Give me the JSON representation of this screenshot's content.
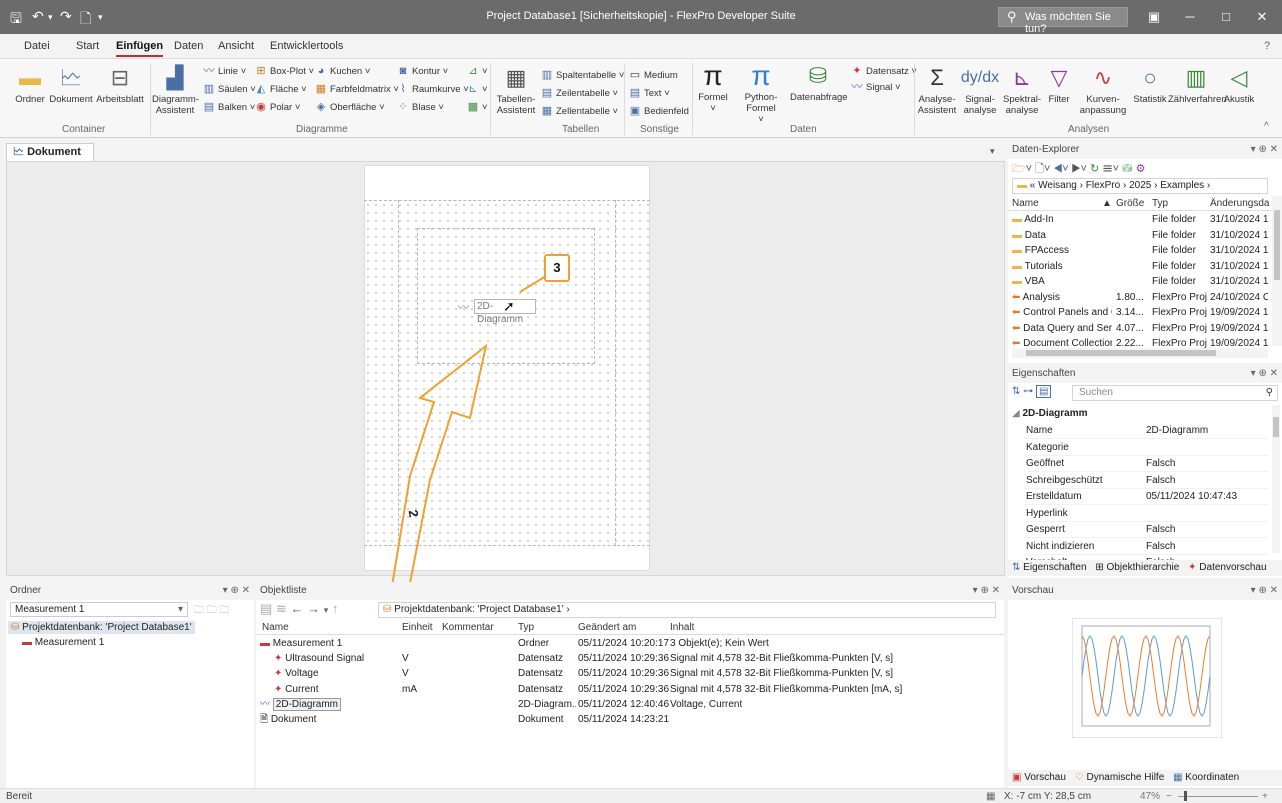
{
  "titlebar": {
    "title": "Project Database1 [Sicherheitskopie] - FlexPro Developer Suite",
    "search_placeholder": "Was möchten Sie tun?"
  },
  "tabs": [
    "Datei",
    "Start",
    "Einfügen",
    "Daten",
    "Ansicht",
    "Entwicklertools"
  ],
  "active_tab": "Einfügen",
  "ribbon": {
    "container": {
      "label": "Container",
      "items": [
        "Ordner",
        "Dokument",
        "Arbeitsblatt"
      ]
    },
    "diagramme": {
      "label": "Diagramme",
      "assistant": "Diagramm-\nAssistent",
      "small": [
        "Linie",
        "Box-Plot",
        "Kuchen",
        "Säulen",
        "Fläche",
        "Farbfeldmatrix",
        "Balken",
        "Polar",
        "Oberfläche",
        "Kontur",
        "Raumkurve",
        "Blase"
      ]
    },
    "tabellen": {
      "label": "Tabellen",
      "assistant": "Tabellen-\nAssistent",
      "small": [
        "Spaltentabelle",
        "Zeilentabelle",
        "Zellentabelle"
      ]
    },
    "sonstige": {
      "label": "Sonstige",
      "small": [
        "Medium",
        "Text",
        "Bedienfeld"
      ]
    },
    "daten": {
      "label": "Daten",
      "items": [
        "Formel",
        "Python-Formel",
        "Datenabfrage"
      ],
      "small": [
        "Datensatz",
        "Signal"
      ]
    },
    "analysen": {
      "label": "Analysen",
      "items": [
        "Analyse-\nAssistent",
        "Signal-\nanalyse",
        "Spektral-\nanalyse",
        "Filter",
        "Kurven-\nanpassung",
        "Statistik",
        "Zählverfahren",
        "Akustik"
      ]
    }
  },
  "document": {
    "tab": "Dokument",
    "diagram_label": "2D-Diagramm"
  },
  "callouts": [
    "1",
    "2",
    "3"
  ],
  "explorer": {
    "title": "Daten-Explorer",
    "breadcrumb": [
      "Weisang",
      "FlexPro",
      "2025",
      "Examples"
    ],
    "columns": [
      "Name",
      "Größe",
      "Typ",
      "Änderungsda"
    ],
    "rows": [
      {
        "name": "Add-In",
        "size": "",
        "type": "File folder",
        "date": "31/10/2024 1",
        "icon": "folder"
      },
      {
        "name": "Data",
        "size": "",
        "type": "File folder",
        "date": "31/10/2024 1",
        "icon": "folder"
      },
      {
        "name": "FPAccess",
        "size": "",
        "type": "File folder",
        "date": "31/10/2024 1",
        "icon": "folder"
      },
      {
        "name": "Tutorials",
        "size": "",
        "type": "File folder",
        "date": "31/10/2024 1",
        "icon": "folder"
      },
      {
        "name": "VBA",
        "size": "",
        "type": "File folder",
        "date": "31/10/2024 1",
        "icon": "folder"
      },
      {
        "name": "Analysis",
        "size": "1.80...",
        "type": "FlexPro Proj...",
        "date": "24/10/2024 C",
        "icon": "project"
      },
      {
        "name": "Control Panels and C...",
        "size": "3.14...",
        "type": "FlexPro Proj...",
        "date": "19/09/2024 1",
        "icon": "project"
      },
      {
        "name": "Data Query and Seri...",
        "size": "4.07...",
        "type": "FlexPro Proj...",
        "date": "19/09/2024 1",
        "icon": "project"
      },
      {
        "name": "Document Collection...",
        "size": "2.22...",
        "type": "FlexPro Proj...",
        "date": "19/09/2024 1",
        "icon": "project"
      }
    ]
  },
  "properties": {
    "title": "Eigenschaften",
    "search_placeholder": "Suchen",
    "section": "2D-Diagramm",
    "rows": [
      {
        "k": "Name",
        "v": "2D-Diagramm"
      },
      {
        "k": "Kategorie",
        "v": ""
      },
      {
        "k": "Geöffnet",
        "v": "Falsch"
      },
      {
        "k": "Schreibgeschützt",
        "v": "Falsch"
      },
      {
        "k": "Erstelldatum",
        "v": "05/11/2024 10:47:43"
      },
      {
        "k": "Hyperlink",
        "v": ""
      },
      {
        "k": "Gesperrt",
        "v": "Falsch"
      },
      {
        "k": "Nicht indizieren",
        "v": "Falsch"
      },
      {
        "k": "Vorschalt",
        "v": "Falsch"
      }
    ],
    "tabs": [
      "Eigenschaften",
      "Objekthierarchie",
      "Datenvorschau"
    ]
  },
  "folder_panel": {
    "title": "Ordner",
    "selected": "Measurement 1",
    "tree": [
      "Projektdatenbank: 'Project Database1'",
      "Measurement 1"
    ]
  },
  "objlist": {
    "title": "Objektliste",
    "path": "Projektdatenbank: 'Project Database1'",
    "columns": [
      "Name",
      "Einheit",
      "Kommentar",
      "Typ",
      "Geändert am",
      "Inhalt"
    ],
    "rows": [
      {
        "name": "Measurement 1",
        "unit": "",
        "typ": "Ordner",
        "date": "05/11/2024 10:20:17",
        "inhalt": "3 Objekt(e); Kein Wert",
        "icon": "folder"
      },
      {
        "name": "Ultrasound Signal",
        "unit": "V",
        "typ": "Datensatz",
        "date": "05/11/2024 10:29:36",
        "inhalt": "Signal mit 4,578 32-Bit Fließkomma-Punkten [V, s]",
        "icon": "signal"
      },
      {
        "name": "Voltage",
        "unit": "V",
        "typ": "Datensatz",
        "date": "05/11/2024 10:29:36",
        "inhalt": "Signal mit 4,578 32-Bit Fließkomma-Punkten [V, s]",
        "icon": "signal"
      },
      {
        "name": "Current",
        "unit": "mA",
        "typ": "Datensatz",
        "date": "05/11/2024 10:29:36",
        "inhalt": "Signal mit 4,578 32-Bit Fließkomma-Punkten [mA, s]",
        "icon": "signal"
      },
      {
        "name": "2D-Diagramm",
        "unit": "",
        "typ": "2D-Diagram...",
        "date": "05/11/2024 12:40:46",
        "inhalt": "Voltage, Current",
        "icon": "diagram"
      },
      {
        "name": "Dokument",
        "unit": "",
        "typ": "Dokument",
        "date": "05/11/2024 14:23:21",
        "inhalt": "",
        "icon": "document"
      }
    ]
  },
  "preview": {
    "title": "Vorschau",
    "tabs": [
      "Vorschau",
      "Dynamische Hilfe",
      "Koordinaten"
    ]
  },
  "status": {
    "left": "Bereit",
    "coords": "X: -7 cm Y: 28,5 cm",
    "zoom": "47%"
  },
  "colors": {
    "accent": "#b8312f",
    "callout": "#f0a030",
    "titlebar": "#6b6b6b"
  }
}
